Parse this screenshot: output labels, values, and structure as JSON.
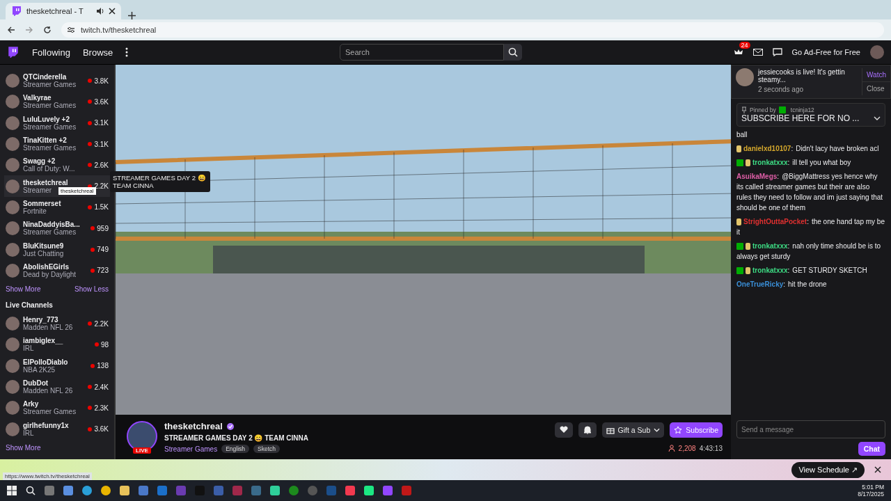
{
  "browser": {
    "tab_title": "thesketchreal - T",
    "url": "twitch.tv/thesketchreal"
  },
  "nav": {
    "links": [
      "Following",
      "Browse"
    ],
    "search": {
      "placeholder": "Search"
    },
    "notification_count": "24",
    "ad_free": "Go Ad-Free for Free"
  },
  "sidebar": {
    "followed": [
      {
        "name": "QTCinderella",
        "game": "Streamer Games",
        "viewers": "3.8K",
        "selected": false
      },
      {
        "name": "Valkyrae",
        "game": "Streamer Games",
        "viewers": "3.6K",
        "selected": false
      },
      {
        "name": "LuluLuvely +2",
        "game": "Streamer Games",
        "viewers": "3.1K",
        "selected": false
      },
      {
        "name": "TinaKitten +2",
        "game": "Streamer Games",
        "viewers": "3.1K",
        "selected": false
      },
      {
        "name": "Swagg +2",
        "game": "Call of Duty: W...",
        "viewers": "2.6K",
        "selected": false
      },
      {
        "name": "thesketchreal",
        "game": "Streamer",
        "viewers": "2.2K",
        "selected": true
      },
      {
        "name": "Sommerset",
        "game": "Fortnite",
        "viewers": "1.5K",
        "selected": false
      },
      {
        "name": "NinaDaddyisBa...",
        "game": "Streamer Games",
        "viewers": "959",
        "selected": false
      },
      {
        "name": "BluKitsune9",
        "game": "Just Chatting",
        "viewers": "749",
        "selected": false
      },
      {
        "name": "AbolishEGirls",
        "game": "Dead by Daylight",
        "viewers": "723",
        "selected": false
      }
    ],
    "show_more": "Show More",
    "show_less": "Show Less",
    "live_heading": "Live Channels",
    "live": [
      {
        "name": "Henry_773",
        "game": "Madden NFL 26",
        "viewers": "2.2K",
        "selected": false
      },
      {
        "name": "iambiglex__",
        "game": "IRL",
        "viewers": "98",
        "selected": false
      },
      {
        "name": "ElPolloDiablo",
        "game": "NBA 2K25",
        "viewers": "138",
        "selected": false
      },
      {
        "name": "DubDot",
        "game": "Madden NFL 26",
        "viewers": "2.4K",
        "selected": false
      },
      {
        "name": "Arky",
        "game": "Streamer Games",
        "viewers": "2.3K",
        "selected": false
      },
      {
        "name": "girlhefunny1x",
        "game": "IRL",
        "viewers": "3.6K",
        "selected": false
      }
    ],
    "show_more_live": "Show More",
    "tooltip": "thesketchreal",
    "title_tooltip": "STREAMER GAMES DAY 2 😄 TEAM CINNA"
  },
  "notification": {
    "text": "jessiecooks is live! It's gettin steamy...",
    "time": "2 seconds ago",
    "watch": "Watch",
    "close": "Close"
  },
  "pinned": {
    "label": "Pinned by",
    "user": "tcninja12",
    "text": "SUBSCRIBE HERE FOR NO ..."
  },
  "chat": [
    {
      "mod_badge": false,
      "hand_badge": false,
      "text": "ball"
    },
    {
      "user": "danielxd10107",
      "sep": ":",
      "color": "#d4a72c",
      "mod_badge": false,
      "hand_badge": true,
      "text": "Didn't lacy have broken acl"
    },
    {
      "user": "tronkatxxx",
      "sep": ":",
      "color": "#3ddc84",
      "mod_badge": true,
      "hand_badge": true,
      "text": "ill tell you what boy"
    },
    {
      "user": "AsuikaMegs",
      "sep": ":",
      "color": "#e05fa8",
      "mod_badge": false,
      "hand_badge": false,
      "text": "@BiggMattress yes hence why its called streamer games but their are also rules they need to follow and im just saying that should be one of them"
    },
    {
      "user": "StrightOuttaPocket",
      "sep": ":",
      "color": "#e03030",
      "mod_badge": false,
      "hand_badge": true,
      "text": "the one hand tap my be it"
    },
    {
      "user": "tronkatxxx",
      "sep": ":",
      "color": "#3ddc84",
      "mod_badge": true,
      "hand_badge": true,
      "text": "nah only time should be is to always get sturdy"
    },
    {
      "user": "tronkatxxx",
      "sep": ":",
      "color": "#3ddc84",
      "mod_badge": true,
      "hand_badge": true,
      "text": "GET STURDY SKETCH"
    },
    {
      "user": "OneTrueRicky",
      "sep": ":",
      "color": "#3a8fd8",
      "mod_badge": false,
      "hand_badge": false,
      "text": "hit the drone"
    }
  ],
  "chat_input": {
    "placeholder": "Send a message"
  },
  "chat_button": "Chat",
  "channel": {
    "name": "thesketchreal",
    "live": "LIVE",
    "title": "STREAMER GAMES DAY 2 😄 TEAM CINNA",
    "game": "Streamer Games",
    "tags": [
      "English",
      "Sketch"
    ],
    "gift": "Gift a Sub",
    "subscribe": "Subscribe",
    "viewers": "2,208",
    "uptime": "4:43:13"
  },
  "schedule_bar": {
    "button": "View Schedule ↗"
  },
  "status_url": "https://www.twitch.tv/thesketchreal",
  "taskbar": {
    "time": "5:01 PM",
    "date": "8/17/2025"
  }
}
